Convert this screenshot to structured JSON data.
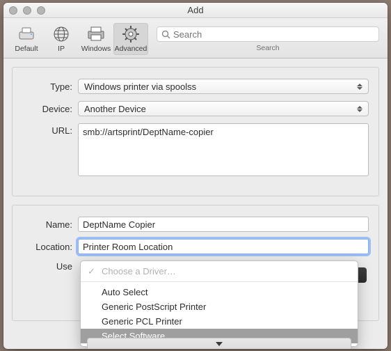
{
  "window": {
    "title": "Add"
  },
  "toolbar": {
    "items": [
      {
        "label": "Default"
      },
      {
        "label": "IP"
      },
      {
        "label": "Windows"
      },
      {
        "label": "Advanced"
      }
    ],
    "search_placeholder": "Search",
    "search_label": "Search"
  },
  "form": {
    "type_label": "Type:",
    "type_value": "Windows printer via spoolss",
    "device_label": "Device:",
    "device_value": "Another Device",
    "url_label": "URL:",
    "url_value": "smb://artsprint/DeptName-copier",
    "name_label": "Name:",
    "name_value": "DeptName Copier",
    "location_label": "Location:",
    "location_value": "Printer Room Location",
    "use_label": "Use"
  },
  "menu": {
    "items": [
      "Choose a Driver…",
      "Auto Select",
      "Generic PostScript Printer",
      "Generic PCL Printer",
      "Select Software…"
    ]
  }
}
